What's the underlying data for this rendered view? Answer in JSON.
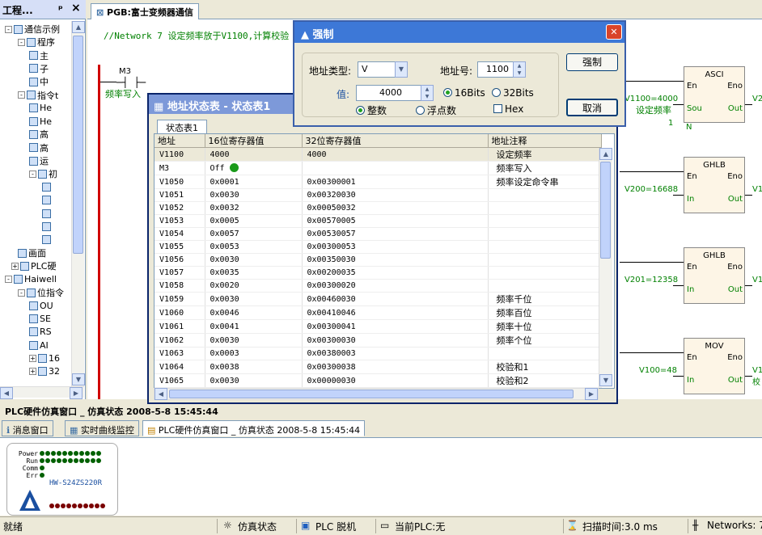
{
  "project_panel": {
    "title": "工程...",
    "pin": "ᵖ",
    "close": "×",
    "items": [
      {
        "label": "通信示例",
        "exp": "-"
      },
      {
        "label": "程序",
        "exp": "-"
      },
      {
        "label": "主",
        "exp": ""
      },
      {
        "label": "子",
        "exp": ""
      },
      {
        "label": "中",
        "exp": ""
      },
      {
        "label": "指令t",
        "exp": "-"
      },
      {
        "label": "He",
        "exp": ""
      },
      {
        "label": "He",
        "exp": ""
      },
      {
        "label": "高",
        "exp": ""
      },
      {
        "label": "高",
        "exp": ""
      },
      {
        "label": "运",
        "exp": ""
      },
      {
        "label": "初",
        "exp": "-"
      },
      {
        "label": "",
        "exp": ""
      },
      {
        "label": "",
        "exp": ""
      },
      {
        "label": "",
        "exp": ""
      },
      {
        "label": "",
        "exp": ""
      },
      {
        "label": "",
        "exp": ""
      },
      {
        "label": "画面",
        "exp": ""
      },
      {
        "label": "PLC硬",
        "exp": "+"
      },
      {
        "label": "Haiwell",
        "exp": "-"
      },
      {
        "label": "位指令",
        "exp": "-"
      },
      {
        "label": "OU",
        "exp": ""
      },
      {
        "label": "SE",
        "exp": ""
      },
      {
        "label": "RS",
        "exp": ""
      },
      {
        "label": "AI",
        "exp": ""
      },
      {
        "label": "16",
        "exp": "+"
      },
      {
        "label": "32",
        "exp": "+"
      }
    ]
  },
  "editor": {
    "tab": "PGB:富士变频器通信",
    "network_comment": "//Network 7  设定频率放于V1100,计算校验",
    "contact_addr": "M3",
    "contact_name": "频率写入",
    "blocks": [
      {
        "name": "ASCI",
        "en": "En",
        "eno": "Eno",
        "in_pin": "Sou",
        "out_pin": "Out",
        "in_value": "V1100=4000",
        "in_note": "设定频率",
        "n_pin": "N",
        "n_value": "1",
        "out_value": "V2"
      },
      {
        "name": "GHLB",
        "en": "En",
        "eno": "Eno",
        "in_pin": "In",
        "out_pin": "Out",
        "in_value": "V200=16688",
        "out_value": "V1"
      },
      {
        "name": "GHLB",
        "en": "En",
        "eno": "Eno",
        "in_pin": "In",
        "out_pin": "Out",
        "in_value": "V201=12358",
        "out_value": "V1"
      },
      {
        "name": "MOV",
        "en": "En",
        "eno": "Eno",
        "in_pin": "In",
        "out_pin": "Out",
        "in_value": "V100=48",
        "out_value": "V1"
      }
    ],
    "mov_out_note": "校"
  },
  "address_window": {
    "title": "地址状态表 - 状态表1",
    "subtab": "状态表1",
    "columns": [
      "地址",
      "16位寄存器值",
      "32位寄存器值",
      "地址注释"
    ],
    "rows": [
      [
        "V1100",
        "4000",
        "4000",
        "设定频率"
      ],
      [
        "M3",
        "Off",
        "",
        "频率写入"
      ],
      [
        "V1050",
        "0x0001",
        "0x00300001",
        "频率设定命令串"
      ],
      [
        "V1051",
        "0x0030",
        "0x00320030",
        ""
      ],
      [
        "V1052",
        "0x0032",
        "0x00050032",
        ""
      ],
      [
        "V1053",
        "0x0005",
        "0x00570005",
        ""
      ],
      [
        "V1054",
        "0x0057",
        "0x00530057",
        ""
      ],
      [
        "V1055",
        "0x0053",
        "0x00300053",
        ""
      ],
      [
        "V1056",
        "0x0030",
        "0x00350030",
        ""
      ],
      [
        "V1057",
        "0x0035",
        "0x00200035",
        ""
      ],
      [
        "V1058",
        "0x0020",
        "0x00300020",
        ""
      ],
      [
        "V1059",
        "0x0030",
        "0x00460030",
        "频率千位"
      ],
      [
        "V1060",
        "0x0046",
        "0x00410046",
        "频率百位"
      ],
      [
        "V1061",
        "0x0041",
        "0x00300041",
        "频率十位"
      ],
      [
        "V1062",
        "0x0030",
        "0x00300030",
        "频率个位"
      ],
      [
        "V1063",
        "0x0003",
        "0x00380003",
        ""
      ],
      [
        "V1064",
        "0x0038",
        "0x00300038",
        "校验和1"
      ],
      [
        "V1065",
        "0x0030",
        "0x00000030",
        "校验和2"
      ]
    ]
  },
  "force_dialog": {
    "title": "强制",
    "addr_type_label": "地址类型:",
    "addr_type_value": "V",
    "addr_no_label": "地址号:",
    "addr_no_value": "1100",
    "value_label": "值:",
    "value_value": "4000",
    "bits16": "16Bits",
    "bits32": "32Bits",
    "integer": "整数",
    "float": "浮点数",
    "hex": "Hex",
    "force_btn": "强制",
    "cancel_btn": "取消"
  },
  "bottom": {
    "title": "PLC硬件仿真窗口 _ 仿真状态 2008-5-8 15:45:44",
    "tabs": [
      "消息窗口",
      "实时曲线监控",
      "PLC硬件仿真窗口 _ 仿真状态 2008-5-8 15:45:44"
    ],
    "led_labels": [
      "Power",
      "Run",
      "Comm",
      "Err"
    ],
    "model": "HW-S24ZS220R"
  },
  "status_bar": {
    "ready": "就绪",
    "sim": "仿真状态",
    "plc": "PLC 脱机",
    "current_plc": "当前PLC:无",
    "scan": "扫描时间:3.0 ms",
    "networks": "Networks: 7"
  }
}
